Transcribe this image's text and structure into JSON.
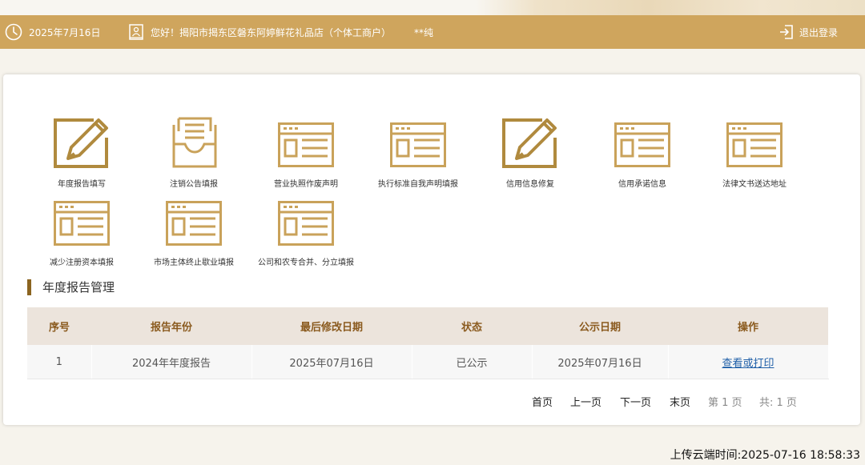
{
  "header": {
    "date": "2025年7月16日",
    "greeting": "您好！揭阳市揭东区磐东阿婷鲜花礼品店（个体工商户）",
    "user": "**纯",
    "logout": "退出登录"
  },
  "tiles": [
    {
      "label": "年度报告填写",
      "icon": "edit-pen-icon"
    },
    {
      "label": "注销公告填报",
      "icon": "inbox-tray-icon"
    },
    {
      "label": "营业执照作废声明",
      "icon": "form-window-icon"
    },
    {
      "label": "执行标准自我声明填报",
      "icon": "form-window-icon"
    },
    {
      "label": "信用信息修复",
      "icon": "edit-pen-icon"
    },
    {
      "label": "信用承诺信息",
      "icon": "form-window-icon"
    },
    {
      "label": "法律文书送达地址",
      "icon": "form-window-icon"
    },
    {
      "label": "减少注册资本填报",
      "icon": "form-window-icon"
    },
    {
      "label": "市场主体终止歇业填报",
      "icon": "form-window-icon"
    },
    {
      "label": "公司和农专合并、分立填报",
      "icon": "form-window-icon"
    }
  ],
  "section_title": "年度报告管理",
  "table": {
    "headers": [
      "序号",
      "报告年份",
      "最后修改日期",
      "状态",
      "公示日期",
      "操作"
    ],
    "rows": [
      [
        "1",
        "2024年年度报告",
        "2025年07月16日",
        "已公示",
        "2025年07月16日",
        "查看或打印"
      ]
    ]
  },
  "pager": {
    "first": "首页",
    "prev": "上一页",
    "next": "下一页",
    "last": "末页",
    "page_info": "第 1 页",
    "total_info": "共:  1 页"
  },
  "upload_time": "上传云端时间:2025-07-16 18:58:33",
  "colors": {
    "header_gold": "#cfa55d",
    "icon_gold": "#c9a25a",
    "accent_brown": "#8b6420",
    "link_blue": "#1f5fa8"
  }
}
